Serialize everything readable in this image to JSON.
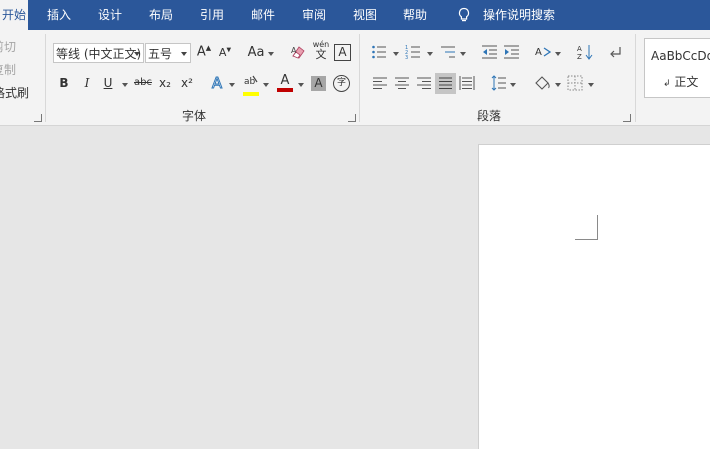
{
  "tabs": {
    "home": "开始",
    "insert": "插入",
    "design": "设计",
    "layout": "布局",
    "references": "引用",
    "mailings": "邮件",
    "review": "审阅",
    "view": "视图",
    "help": "帮助",
    "tell_me": "操作说明搜索"
  },
  "clipboard": {
    "cut": "剪切",
    "copy": "复制",
    "format_painter": "格式刷"
  },
  "font": {
    "family": "等线 (中文正文)",
    "size": "五号",
    "change_case": "Aa",
    "phonetic_top": "wén",
    "phonetic_bottom": "文",
    "bold": "B",
    "italic": "I",
    "underline": "U",
    "strikethrough": "abc",
    "subscript": "x₂",
    "superscript": "x²",
    "enclose_char": "字",
    "group_label": "字体"
  },
  "paragraph": {
    "group_label": "段落"
  },
  "styles": {
    "preview": "AaBbCcDd",
    "normal": "正文"
  },
  "colors": {
    "ribbon_blue": "#2b579a",
    "highlight": "#ffff00",
    "font_color": "#c00000"
  }
}
